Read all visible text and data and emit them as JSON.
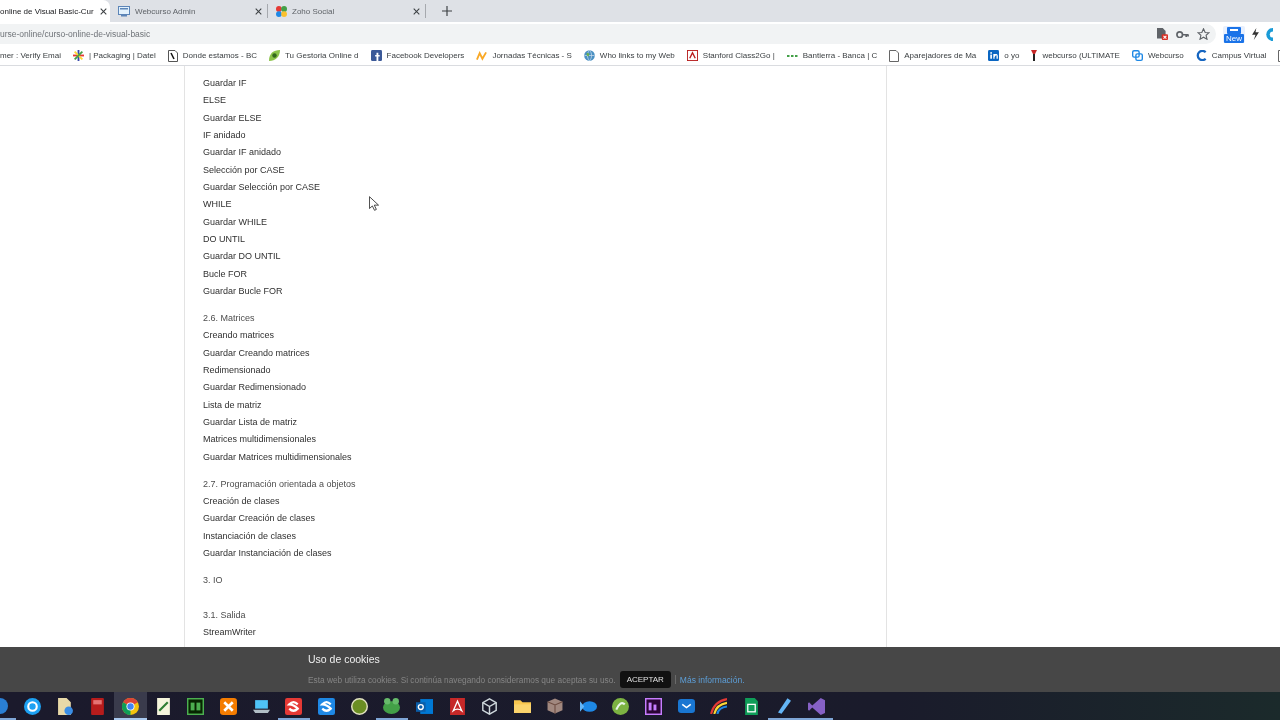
{
  "browser": {
    "tabs": [
      {
        "title": "online de Visual Basic-Cur",
        "selected": true
      },
      {
        "title": "Webcurso Admin",
        "selected": false
      },
      {
        "title": "Zoho Social",
        "selected": false
      }
    ],
    "address": "urse-online/curso-online-de-visual-basic",
    "extension_badge": "New",
    "bookmarks": [
      {
        "title": "mer : Verify Emai"
      },
      {
        "title": "| Packaging | Datel"
      },
      {
        "title": "Donde estamos - BC"
      },
      {
        "title": "Tu Gestoria Online d"
      },
      {
        "title": "Facebook Developers"
      },
      {
        "title": "Jornadas Técnicas - S"
      },
      {
        "title": "Who links to my Web"
      },
      {
        "title": "Stanford Class2Go |"
      },
      {
        "title": "Bantierra - Banca | C"
      },
      {
        "title": "Aparejadores de Ma"
      },
      {
        "title": "o yo"
      },
      {
        "title": "webcurso (ULTIMATE"
      },
      {
        "title": "Webcurso"
      },
      {
        "title": "Campus Virtual"
      }
    ]
  },
  "course": {
    "sections": [
      {
        "lessons": [
          "Guardar IF",
          "ELSE",
          "Guardar ELSE",
          "IF anidado",
          "Guardar IF anidado",
          "Selección por CASE",
          "Guardar Selección por CASE",
          "WHILE",
          "Guardar WHILE",
          "DO UNTIL",
          "Guardar DO UNTIL",
          "Bucle FOR",
          "Guardar Bucle FOR"
        ]
      },
      {
        "title": "2.6. Matrices",
        "lessons": [
          "Creando matrices",
          "Guardar Creando matrices",
          "Redimensionado",
          "Guardar Redimensionado",
          "Lista de matriz",
          "Guardar Lista de matriz",
          "Matrices multidimensionales",
          "Guardar Matrices multidimensionales"
        ]
      },
      {
        "title": "2.7. Programación orientada a objetos",
        "lessons": [
          "Creación de clases",
          "Guardar Creación de clases",
          "Instanciación de clases",
          "Guardar Instanciación de clases"
        ]
      },
      {
        "title": "3. IO",
        "children": [
          {
            "title": "3.1. Salida",
            "lessons": [
              "StreamWriter"
            ]
          }
        ]
      }
    ]
  },
  "cookie_notice": {
    "title": "Uso de cookies",
    "message": "Esta web utiliza cookies. Si continúa navegando consideramos que aceptas su uso.",
    "accept_button": "ACEPTAR",
    "more_link": "Más información."
  },
  "taskbar": {
    "apps": [
      {
        "running": true,
        "selected": false
      },
      {
        "running": false,
        "selected": false
      },
      {
        "running": false,
        "selected": false
      },
      {
        "running": false,
        "selected": false
      },
      {
        "running": true,
        "selected": true
      },
      {
        "running": false,
        "selected": false
      },
      {
        "running": false,
        "selected": false
      },
      {
        "running": false,
        "selected": false
      },
      {
        "running": false,
        "selected": false
      },
      {
        "running": true,
        "selected": false
      },
      {
        "running": false,
        "selected": false
      },
      {
        "running": false,
        "selected": false
      },
      {
        "running": true,
        "selected": false
      },
      {
        "running": false,
        "selected": false
      },
      {
        "running": false,
        "selected": false
      },
      {
        "running": false,
        "selected": false
      },
      {
        "running": false,
        "selected": false
      },
      {
        "running": false,
        "selected": false
      },
      {
        "running": false,
        "selected": false
      },
      {
        "running": false,
        "selected": false
      },
      {
        "running": false,
        "selected": false
      },
      {
        "running": false,
        "selected": false
      },
      {
        "running": false,
        "selected": false
      },
      {
        "running": false,
        "selected": false
      },
      {
        "running": true,
        "selected": false
      },
      {
        "running": true,
        "selected": false
      }
    ]
  }
}
